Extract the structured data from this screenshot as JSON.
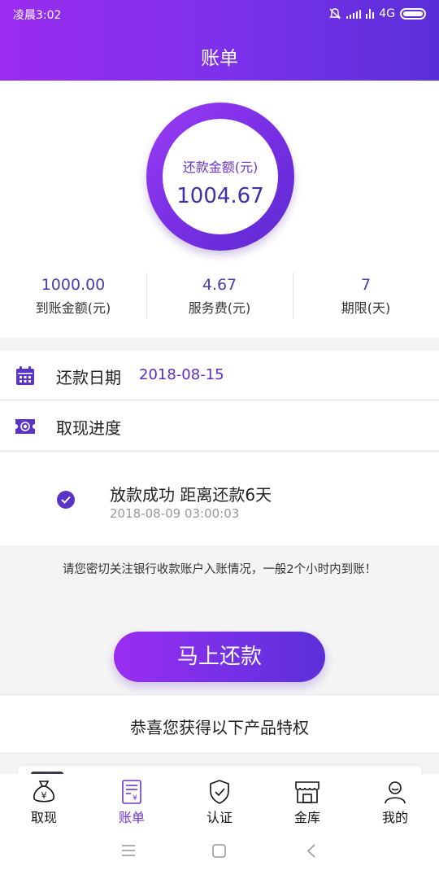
{
  "status_bar": {
    "time": "凌晨3:02",
    "network": "4G"
  },
  "header": {
    "title": "账单"
  },
  "summary": {
    "ring_label": "还款金额(元)",
    "ring_value": "1004.67",
    "stats": [
      {
        "value": "1000.00",
        "label": "到账金额(元)"
      },
      {
        "value": "4.67",
        "label": "服务费(元)"
      },
      {
        "value": "7",
        "label": "期限(天)"
      }
    ]
  },
  "repay_date": {
    "label": "还款日期",
    "value": "2018-08-15"
  },
  "withdraw_progress": {
    "label": "取现进度",
    "step_title": "放款成功 距离还款6天",
    "step_time": "2018-08-09 03:00:03"
  },
  "notice": "请您密切关注银行收款账户入账情况，一般2个小时内到账！",
  "pay_button": "马上还款",
  "privilege_title": "恭喜您获得以下产品特权",
  "tabs": [
    {
      "label": "取现",
      "icon": "money-bag-icon"
    },
    {
      "label": "账单",
      "icon": "bill-icon",
      "active": true
    },
    {
      "label": "认证",
      "icon": "shield-check-icon"
    },
    {
      "label": "金库",
      "icon": "store-icon"
    },
    {
      "label": "我的",
      "icon": "user-icon"
    }
  ],
  "colors": {
    "accent": "#7b31ea",
    "accent_dark": "#5a2fd8",
    "accent_light": "#9a2cf0"
  }
}
